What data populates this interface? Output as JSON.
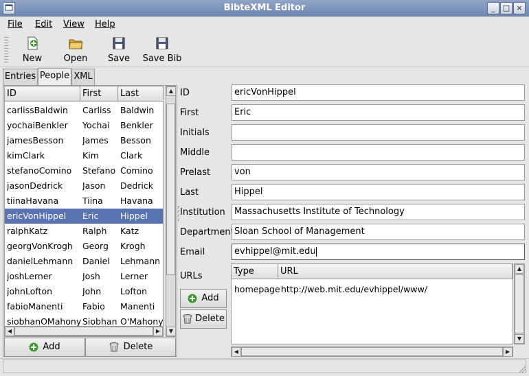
{
  "window": {
    "title": "BibteXML Editor",
    "controls": [
      "_",
      "□",
      "×"
    ]
  },
  "menubar": {
    "items": [
      {
        "label": "File",
        "mnemonic": "F"
      },
      {
        "label": "Edit",
        "mnemonic": "E"
      },
      {
        "label": "View",
        "mnemonic": "V"
      },
      {
        "label": "Help",
        "mnemonic": "H"
      }
    ]
  },
  "toolbar": {
    "buttons": [
      {
        "label": "New",
        "icon": "new-document-icon"
      },
      {
        "label": "Open",
        "icon": "folder-open-icon"
      },
      {
        "label": "Save",
        "icon": "floppy-disk-icon"
      },
      {
        "label": "Save Bib",
        "icon": "floppy-disk-icon"
      }
    ]
  },
  "tabs": [
    {
      "label": "Entries",
      "active": false
    },
    {
      "label": "People",
      "active": true
    },
    {
      "label": "XML",
      "active": false
    }
  ],
  "people": {
    "columns": [
      "ID",
      "First",
      "Last"
    ],
    "rows": [
      {
        "id": "carlissBaldwin",
        "first": "Carliss",
        "last": "Baldwin"
      },
      {
        "id": "yochaiBenkler",
        "first": "Yochai",
        "last": "Benkler"
      },
      {
        "id": "jamesBesson",
        "first": "James",
        "last": "Besson"
      },
      {
        "id": "kimClark",
        "first": "Kim",
        "last": "Clark"
      },
      {
        "id": "stefanoComino",
        "first": "Stefano",
        "last": "Comino"
      },
      {
        "id": "jasonDedrick",
        "first": "Jason",
        "last": "Dedrick"
      },
      {
        "id": "tiinaHavana",
        "first": "Tiina",
        "last": "Havana"
      },
      {
        "id": "ericVonHippel",
        "first": "Eric",
        "last": "Hippel"
      },
      {
        "id": "ralphKatz",
        "first": "Ralph",
        "last": "Katz"
      },
      {
        "id": "georgVonKrogh",
        "first": "Georg",
        "last": "Krogh"
      },
      {
        "id": "danielLehmann",
        "first": "Daniel",
        "last": "Lehmann"
      },
      {
        "id": "joshLerner",
        "first": "Josh",
        "last": "Lerner"
      },
      {
        "id": "johnLofton",
        "first": "John",
        "last": "Lofton"
      },
      {
        "id": "fabioManenti",
        "first": "Fabio",
        "last": "Manenti"
      },
      {
        "id": "siobhanOMahony",
        "first": "Siobhan",
        "last": "O'Mahony"
      }
    ],
    "selected_id": "ericVonHippel",
    "add_label": "Add",
    "delete_label": "Delete"
  },
  "form": {
    "fields": [
      {
        "label": "ID",
        "value": "ericVonHippel"
      },
      {
        "label": "First",
        "value": "Eric"
      },
      {
        "label": "Initials",
        "value": ""
      },
      {
        "label": "Middle",
        "value": ""
      },
      {
        "label": "Prelast",
        "value": "von"
      },
      {
        "label": "Last",
        "value": "Hippel"
      },
      {
        "label": "Institution",
        "value": "Massachusetts Institute of Technology"
      },
      {
        "label": "Department",
        "value": "Sloan School of Management"
      },
      {
        "label": "Email",
        "value": "evhippel@mit.edu"
      }
    ],
    "urls_label": "URLs",
    "url_columns": [
      "Type",
      "URL"
    ],
    "urls": [
      {
        "type": "homepage",
        "url": "http://web.mit.edu/evhippel/www/"
      }
    ],
    "add_label": "Add",
    "delete_label": "Delete"
  },
  "colors": {
    "selection": "#5973b0",
    "titlebar": "#7a91ba",
    "add_icon": "#3f9a2e"
  }
}
